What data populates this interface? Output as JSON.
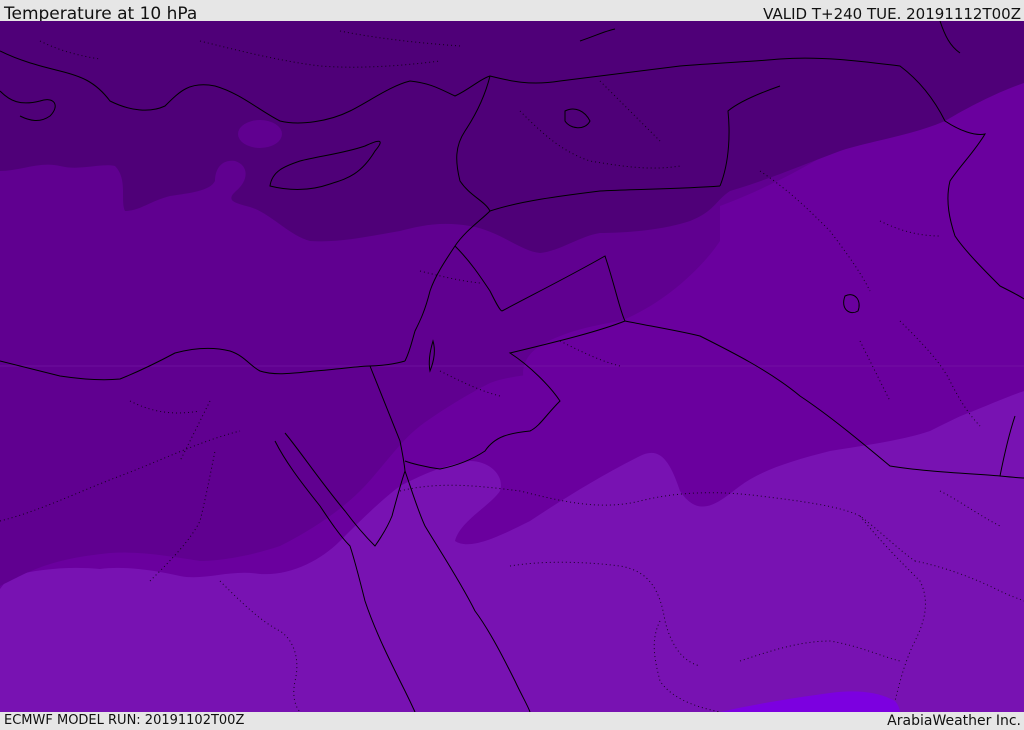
{
  "header": {
    "title": "Temperature at 10 hPa",
    "valid": "VALID T+240 TUE. 20191112T00Z"
  },
  "footer": {
    "model_run": "ECMWF MODEL RUN: 20191102T00Z",
    "credit": "ArabiaWeather Inc."
  },
  "colors": {
    "band_darkest": "#4f0078",
    "band_dark": "#600090",
    "band_mid": "#6a009e",
    "band_light": "#7812b2",
    "band_lightest": "#7c00e0",
    "border_line": "#000000"
  }
}
